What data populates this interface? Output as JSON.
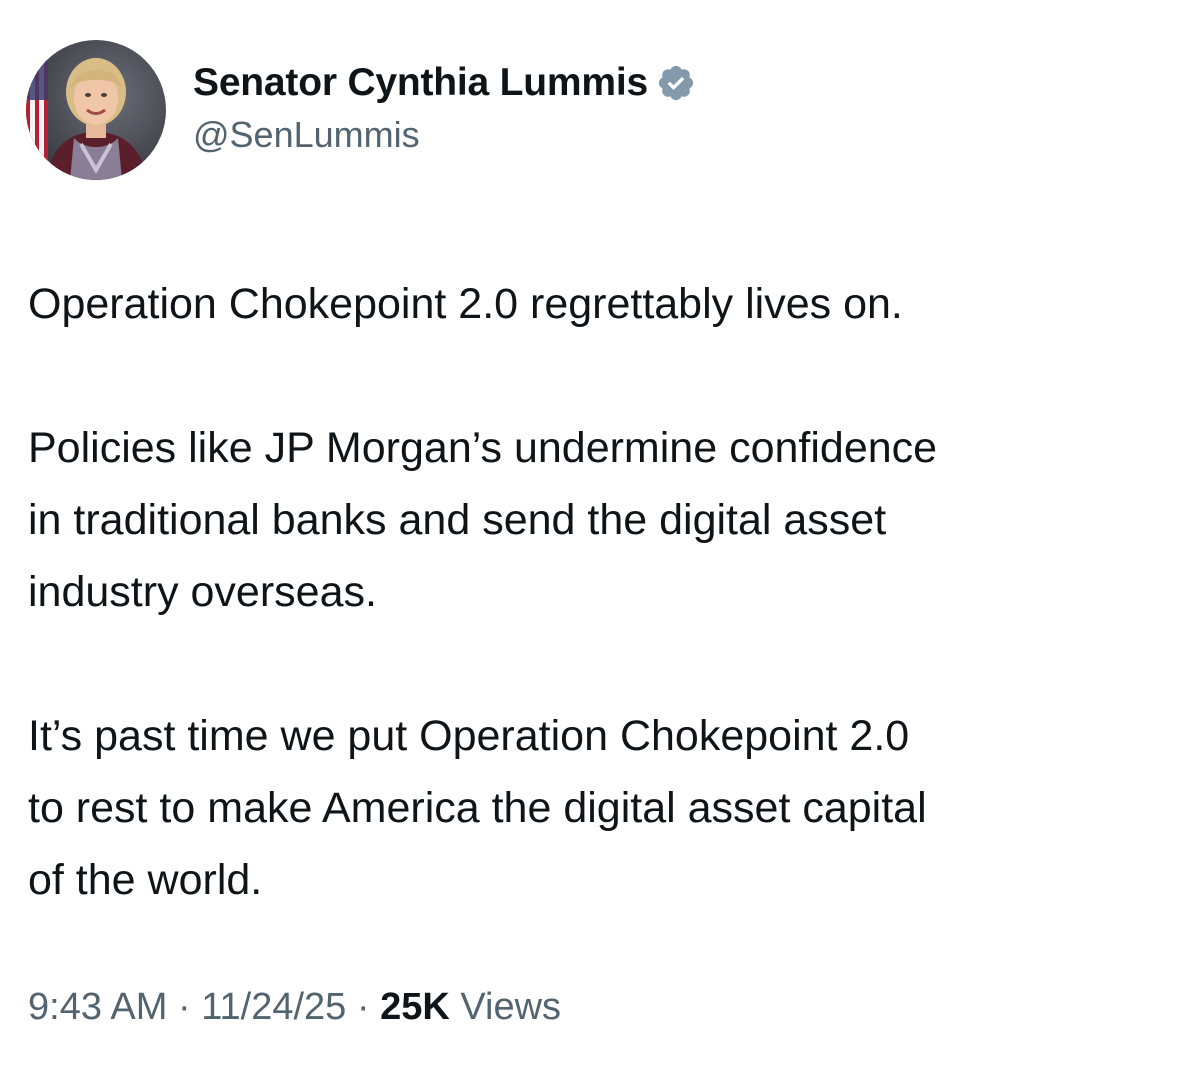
{
  "author": {
    "display_name": "Senator Cynthia Lummis",
    "handle": "@SenLummis",
    "verified_icon": "verified-badge-icon",
    "verified_color": "#829aab"
  },
  "tweet": {
    "paragraphs": [
      "Operation Chokepoint 2.0 regrettably lives on.",
      "Policies like JP Morgan’s undermine confidence\nin traditional banks and send the digital asset\nindustry overseas.",
      "It’s past time we put Operation Chokepoint 2.0\nto rest to make America the digital asset capital\nof the world."
    ]
  },
  "meta": {
    "time": "9:43 AM",
    "separator": " · ",
    "date": "11/24/25",
    "views_count": "25K",
    "views_label": " Views"
  },
  "colors": {
    "text_primary": "#0f1419",
    "text_secondary": "#536471",
    "background": "#ffffff"
  }
}
